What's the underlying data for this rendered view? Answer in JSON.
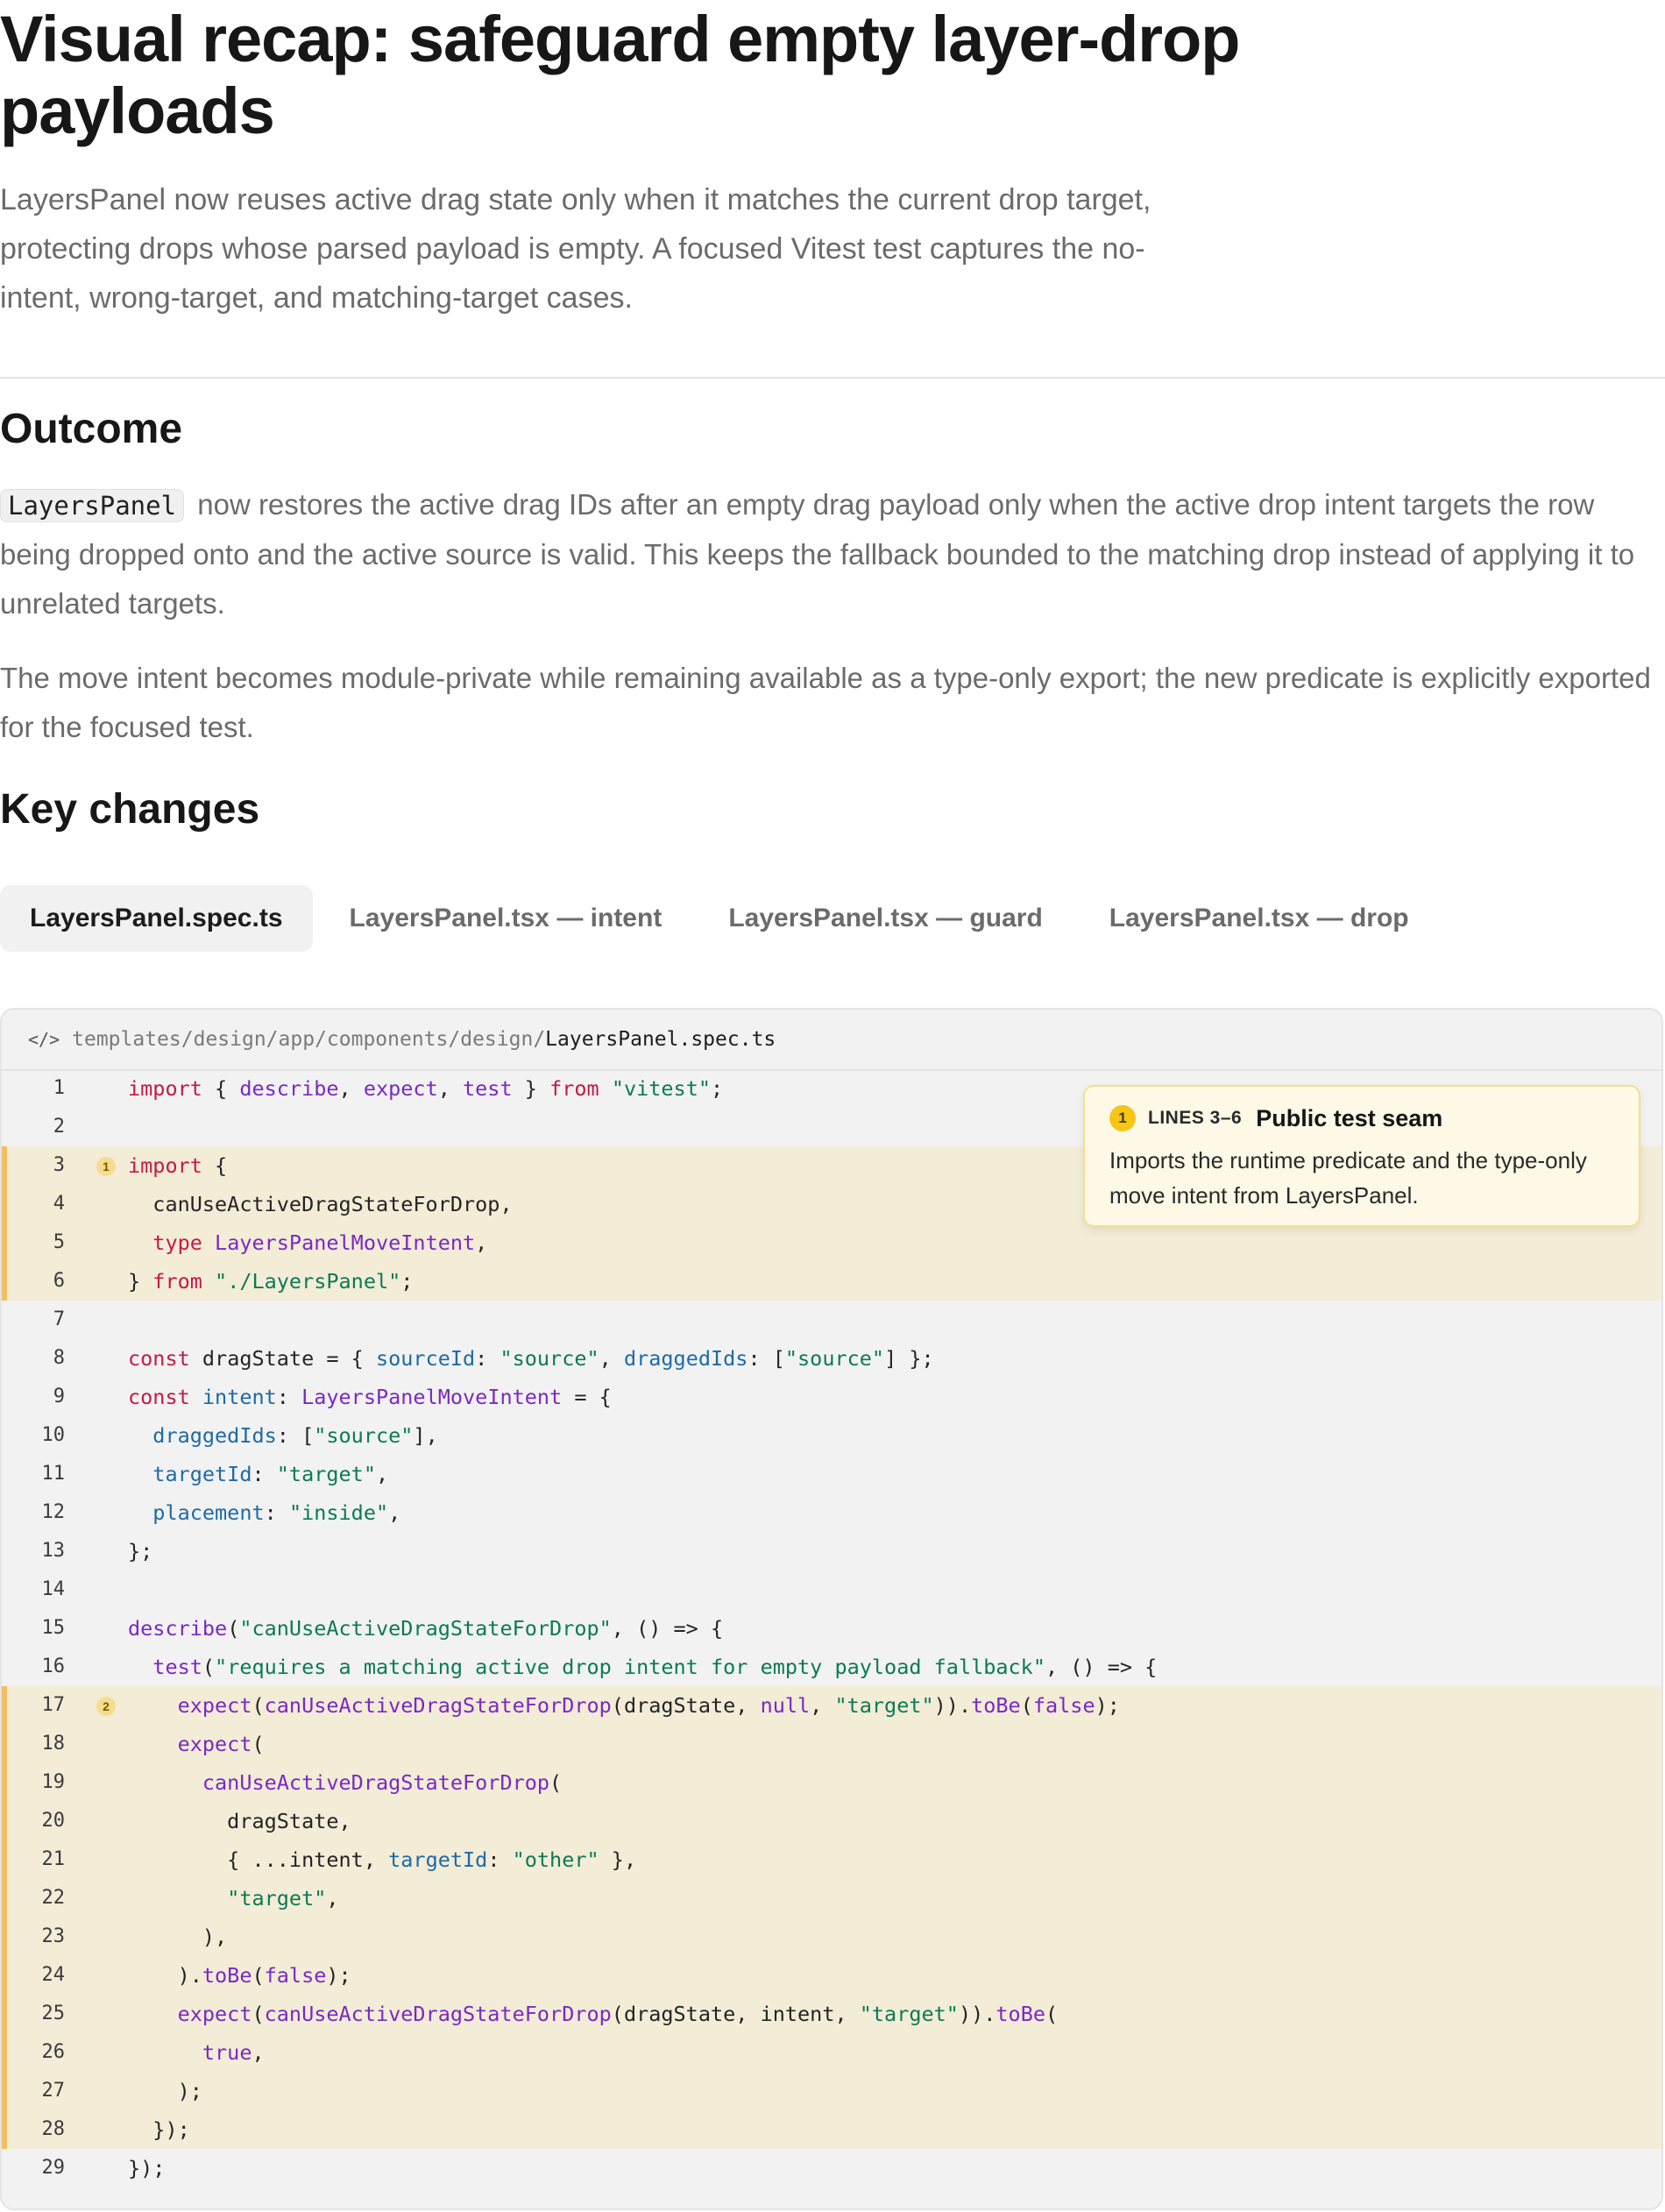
{
  "header": {
    "title": "Visual recap: safeguard empty layer-drop payloads",
    "subtitle": "LayersPanel now reuses active drag state only when it matches the current drop target, protecting drops whose parsed payload is empty. A focused Vitest test captures the no-intent, wrong-target, and matching-target cases."
  },
  "outcome": {
    "heading": "Outcome",
    "inline_code": "LayersPanel",
    "paragraph1_rest": "now restores the active drag IDs after an empty drag payload only when the active drop intent targets the row being dropped onto and the active source is valid. This keeps the fallback bounded to the matching drop instead of applying it to unrelated targets.",
    "paragraph2": "The move intent becomes module-private while remaining available as a type-only export; the new predicate is explicitly exported for the focused test."
  },
  "key_changes": {
    "heading": "Key changes",
    "tabs": [
      {
        "label": "LayersPanel.spec.ts",
        "active": true
      },
      {
        "label": "LayersPanel.tsx — intent",
        "active": false
      },
      {
        "label": "LayersPanel.tsx — guard",
        "active": false
      },
      {
        "label": "LayersPanel.tsx — drop",
        "active": false
      }
    ]
  },
  "code": {
    "icon": "code-icon",
    "path_prefix": "templates/design/app/components/design/",
    "file_name": "LayersPanel.spec.ts",
    "lines": [
      {
        "n": "1",
        "code": "import { describe, expect, test } from \"vitest\";"
      },
      {
        "n": "2",
        "code": ""
      },
      {
        "n": "3",
        "code": "import {",
        "marker": "1"
      },
      {
        "n": "4",
        "code": "  canUseActiveDragStateForDrop,"
      },
      {
        "n": "5",
        "code": "  type LayersPanelMoveIntent,"
      },
      {
        "n": "6",
        "code": "} from \"./LayersPanel\";"
      },
      {
        "n": "7",
        "code": ""
      },
      {
        "n": "8",
        "code": "const dragState = { sourceId: \"source\", draggedIds: [\"source\"] };"
      },
      {
        "n": "9",
        "code": "const intent: LayersPanelMoveIntent = {"
      },
      {
        "n": "10",
        "code": "  draggedIds: [\"source\"],"
      },
      {
        "n": "11",
        "code": "  targetId: \"target\","
      },
      {
        "n": "12",
        "code": "  placement: \"inside\","
      },
      {
        "n": "13",
        "code": "};"
      },
      {
        "n": "14",
        "code": ""
      },
      {
        "n": "15",
        "code": "describe(\"canUseActiveDragStateForDrop\", () => {"
      },
      {
        "n": "16",
        "code": "  test(\"requires a matching active drop intent for empty payload fallback\", () => {"
      },
      {
        "n": "17",
        "code": "    expect(canUseActiveDragStateForDrop(dragState, null, \"target\")).toBe(false);",
        "marker": "2"
      },
      {
        "n": "18",
        "code": "    expect("
      },
      {
        "n": "19",
        "code": "      canUseActiveDragStateForDrop("
      },
      {
        "n": "20",
        "code": "        dragState,"
      },
      {
        "n": "21",
        "code": "        { ...intent, targetId: \"other\" },"
      },
      {
        "n": "22",
        "code": "        \"target\","
      },
      {
        "n": "23",
        "code": "      ),"
      },
      {
        "n": "24",
        "code": "    ).toBe(false);"
      },
      {
        "n": "25",
        "code": "    expect(canUseActiveDragStateForDrop(dragState, intent, \"target\")).toBe("
      },
      {
        "n": "26",
        "code": "      true,"
      },
      {
        "n": "27",
        "code": "    );"
      },
      {
        "n": "28",
        "code": "  });"
      },
      {
        "n": "29",
        "code": "});"
      }
    ],
    "highlight_ranges": [
      [
        3,
        6
      ],
      [
        17,
        28
      ]
    ]
  },
  "callout": {
    "badge": "1",
    "lines_label": "LINES 3–6",
    "title": "Public test seam",
    "body": "Imports the runtime predicate and the type-only move intent from LayersPanel."
  },
  "colors": {
    "highlight_bg": "#f3ecd7",
    "highlight_bar": "#f5bd62",
    "keyword": "#c41a44",
    "string": "#0b7a55",
    "property": "#1d6aa6",
    "function": "#7a29c2",
    "callout_bg": "#fdf9e6"
  }
}
